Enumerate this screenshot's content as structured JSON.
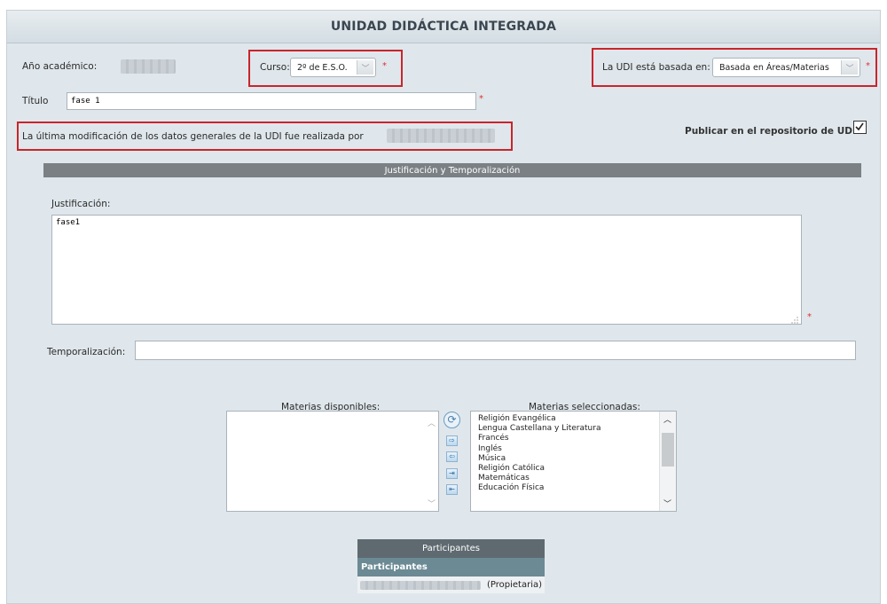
{
  "header": {
    "title": "UNIDAD DIDÁCTICA INTEGRADA"
  },
  "general": {
    "academic_year_label": "Año académico:",
    "course_label": "Curso:",
    "course_value": "2º de E.S.O.",
    "based_on_label": "La UDI está basada en:",
    "based_on_value": "Basada en Áreas/Materias",
    "title_label": "Título",
    "title_value": "fase 1",
    "publish_label": "Publicar en el repositorio de UDI's",
    "publish_checked": true,
    "last_modified_label": "La última modificación de los datos generales de la UDI fue realizada por",
    "required_mark": "*",
    "dropdown_glyph": "﹀"
  },
  "justification_section": {
    "title": "Justificación y Temporalización",
    "justification_label": "Justificación:",
    "justification_value": "fase1",
    "temporalization_label": "Temporalización:",
    "temporalization_value": ""
  },
  "subjects": {
    "available_label": "Materias disponibles:",
    "selected_label": "Materias seleccionadas:",
    "selected_items": [
      "Religión Evangélica",
      "Lengua Castellana y Literatura",
      "Francés",
      "Inglés",
      "Música",
      "Religión Católica",
      "Matemáticas",
      "Educación Física"
    ],
    "transfer_buttons": [
      "move-right",
      "move-left",
      "move-all-right",
      "move-all-left"
    ],
    "icons": {
      "refresh": "⟳",
      "scroll_up": "︿",
      "scroll_down": "﹀",
      "move_right": "⇨",
      "move_left": "⇦",
      "move_all_right": "⇥",
      "move_all_left": "⇤"
    }
  },
  "participants": {
    "header": "Participantes",
    "subheader": "Participantes",
    "owner_suffix": "(Propietaria)"
  },
  "colors": {
    "accent_red": "#c9252b",
    "section_bar": "#7b8084",
    "participants_sub": "#6b8a94"
  }
}
